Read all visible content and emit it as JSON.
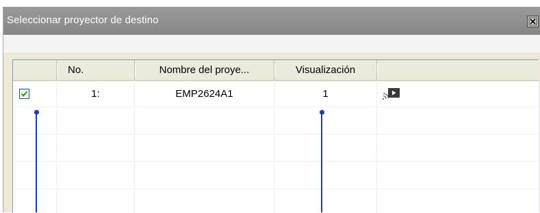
{
  "dialog": {
    "title": "Seleccionar proyector de destino"
  },
  "table": {
    "columns": [
      "",
      "No.",
      "Nombre del proye...",
      "Visualización",
      ""
    ],
    "rows": [
      {
        "checked": true,
        "no": "1:",
        "name": "EMP2624A1",
        "display": "1",
        "icon": "projector-cast-icon"
      },
      {
        "checked": false,
        "no": "",
        "name": "",
        "display": "",
        "icon": ""
      },
      {
        "checked": false,
        "no": "",
        "name": "",
        "display": "",
        "icon": ""
      },
      {
        "checked": false,
        "no": "",
        "name": "",
        "display": "",
        "icon": ""
      },
      {
        "checked": false,
        "no": "",
        "name": "",
        "display": "",
        "icon": ""
      }
    ]
  },
  "colors": {
    "titlebar": "#8c8c8c",
    "callout": "#1a3fa6",
    "checkmark": "#21a121"
  }
}
